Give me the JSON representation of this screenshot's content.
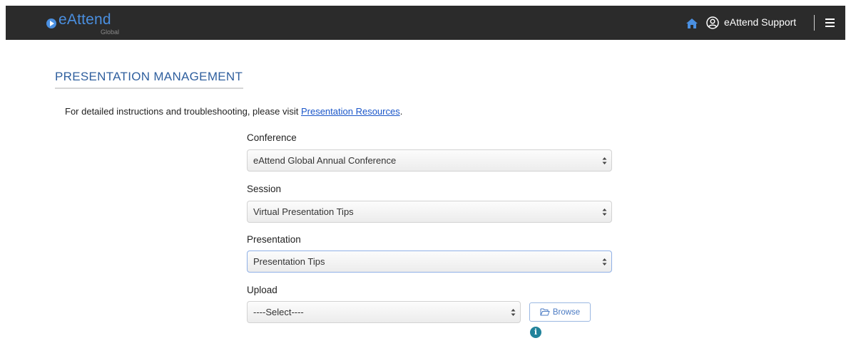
{
  "header": {
    "brand_name": "eAttend",
    "brand_sub": "Global",
    "support_label": "eAttend Support",
    "icons": [
      "home-icon",
      "user-circle-icon",
      "hamburger-menu-icon"
    ]
  },
  "page": {
    "title": "PRESENTATION MANAGEMENT",
    "intro_text": "For detailed instructions and troubleshooting, please visit ",
    "intro_link": "Presentation Resources",
    "intro_end": "."
  },
  "form": {
    "conference": {
      "label": "Conference",
      "value": "eAttend Global Annual Conference"
    },
    "session": {
      "label": "Session",
      "value": "Virtual Presentation Tips"
    },
    "presentation": {
      "label": "Presentation",
      "value": "Presentation Tips"
    },
    "upload": {
      "label": "Upload",
      "value": "----Select----"
    },
    "browse_label": "Browse",
    "info_glyph": "i"
  },
  "colors": {
    "topbar": "#2b2b2b",
    "brand": "#4a8fe0",
    "title": "#2f5f9e",
    "link": "#1a56c9",
    "info": "#21839b"
  }
}
